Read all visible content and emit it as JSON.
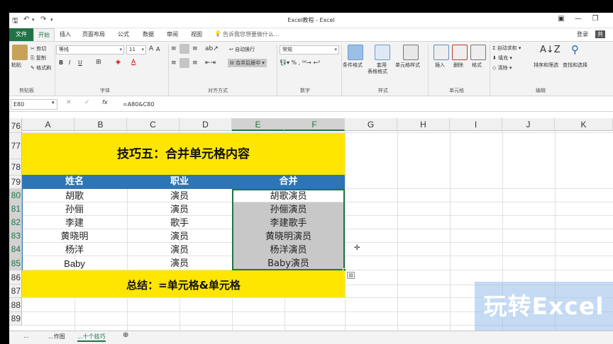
{
  "window": {
    "title": "Excel教程 - Excel",
    "share": "共"
  },
  "ribbon_tabs": [
    "文件",
    "开始",
    "插入",
    "页面布局",
    "公式",
    "数据",
    "审阅",
    "视图"
  ],
  "tell_me": "告诉我您想要做什么...",
  "sign_in": "登录",
  "clipboard": {
    "paste": "粘贴",
    "cut": "剪切",
    "copy": "复制",
    "format_painter": "格式刷",
    "group": "剪贴板"
  },
  "font": {
    "name": "等线",
    "size": "11",
    "bold": "B",
    "italic": "I",
    "underline": "U",
    "group": "字体"
  },
  "alignment": {
    "wrap": "自动换行",
    "merge": "合并后居中",
    "group": "对齐方式"
  },
  "number": {
    "format": "常规",
    "group": "数字"
  },
  "styles": {
    "conditional": "条件格式",
    "table1": "套用",
    "table2": "表格格式",
    "cell_styles": "单元格样式",
    "group": "样式"
  },
  "cells": {
    "insert": "插入",
    "delete": "删除",
    "format": "格式",
    "group": "单元格"
  },
  "editing": {
    "autosum": "自动求和",
    "fill": "填充",
    "clear": "清除",
    "sort": "排序和筛选",
    "find": "查找和选择",
    "group": "编辑"
  },
  "formula_bar": {
    "name_box": "E80",
    "fx": "fx",
    "formula": "=A80&C80"
  },
  "columns": [
    "A",
    "B",
    "C",
    "D",
    "E",
    "F",
    "G",
    "H",
    "I",
    "J",
    "K"
  ],
  "rows": [
    "76",
    "77",
    "78",
    "79",
    "80",
    "81",
    "82",
    "83",
    "84",
    "85",
    "86",
    "87",
    "88",
    "89"
  ],
  "sheet": {
    "title": "技巧五：合并单元格内容",
    "headers": {
      "name": "姓名",
      "job": "职业",
      "merge": "合并"
    },
    "data": [
      {
        "name": "胡歌",
        "job": "演员",
        "merge": "胡歌演员"
      },
      {
        "name": "孙俪",
        "job": "演员",
        "merge": "孙俪演员"
      },
      {
        "name": "李建",
        "job": "歌手",
        "merge": "李建歌手"
      },
      {
        "name": "黄晓明",
        "job": "演员",
        "merge": "黄晓明演员"
      },
      {
        "name": "杨洋",
        "job": "演员",
        "merge": "杨洋演员"
      },
      {
        "name": "Baby",
        "job": "演员",
        "merge": "Baby演员"
      }
    ],
    "summary": "总结：=单元格&单元格"
  },
  "sheet_tabs": [
    "...",
    "...作图",
    "...十个技巧"
  ],
  "watermark": "玩转Excel",
  "colors": {
    "excel_green": "#217346",
    "banner_yellow": "#ffe600",
    "header_blue": "#2e75b6",
    "selection_grey": "#c8c8c8"
  }
}
